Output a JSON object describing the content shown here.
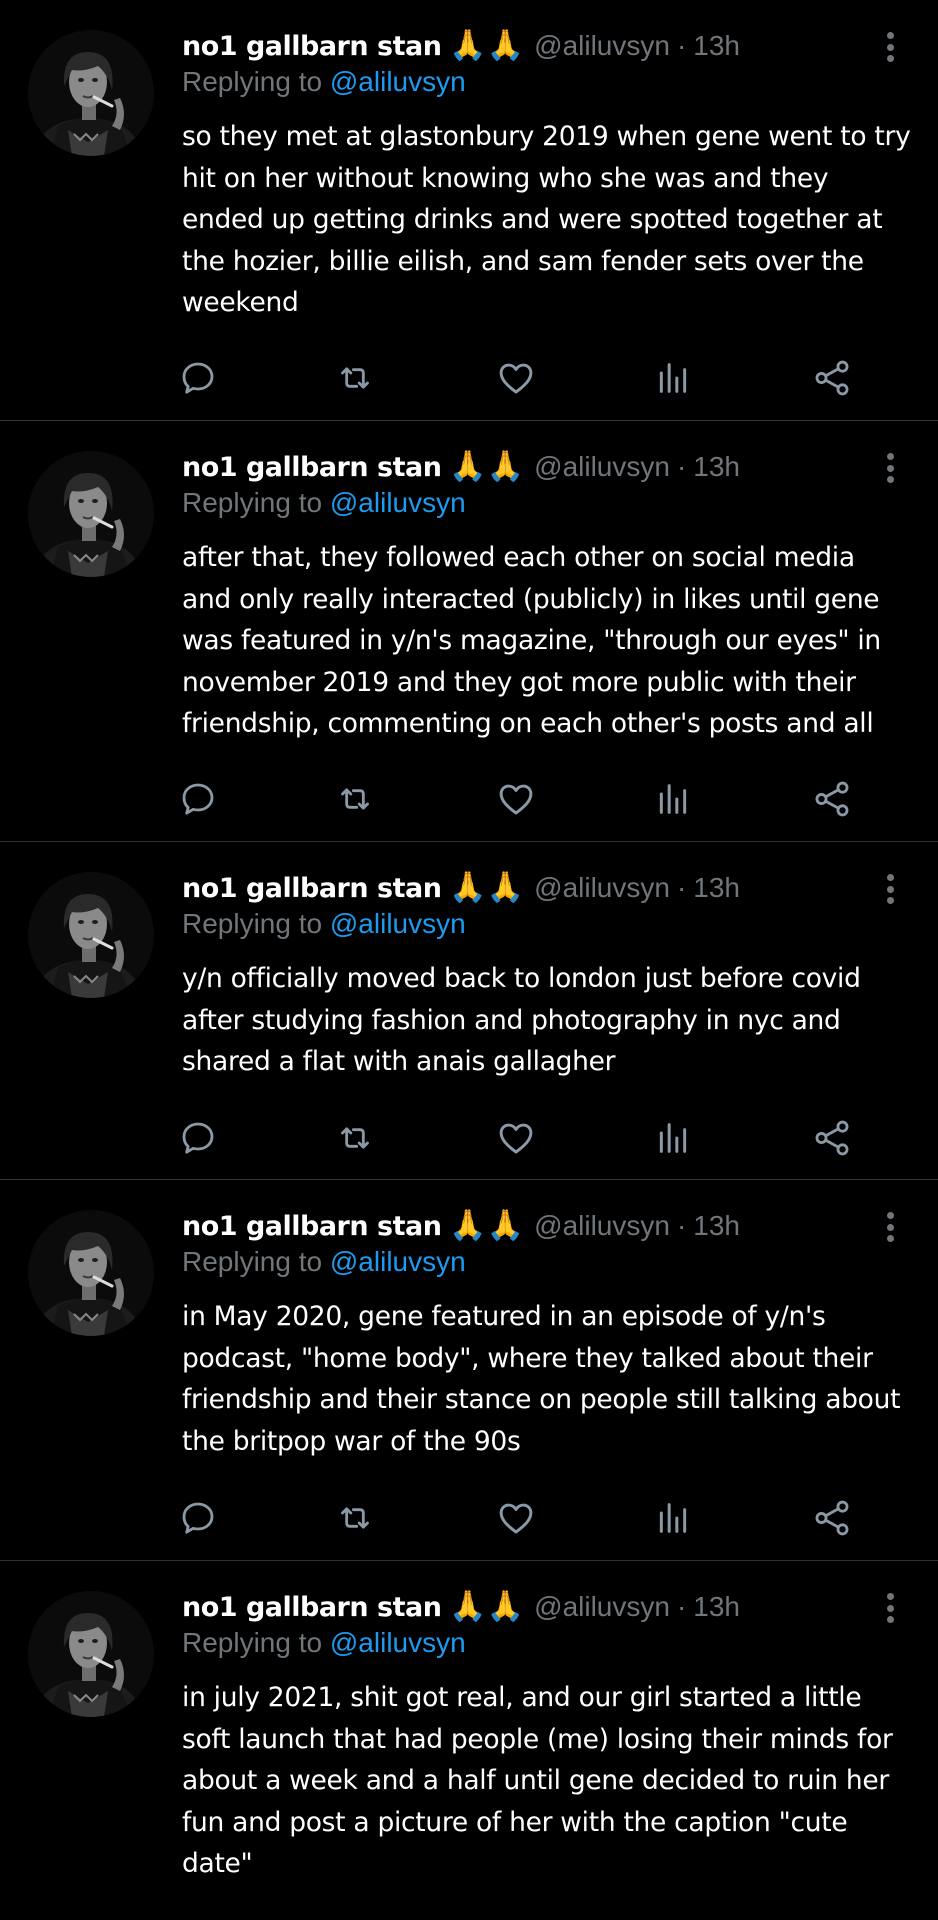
{
  "theme": {
    "background": "#000000",
    "text_primary": "#ffffff",
    "text_secondary": "#71767b",
    "accent": "#1d9bf0",
    "divider": "#2f3336"
  },
  "tweets": [
    {
      "display_name": "no1 gallbarn stan",
      "emoji": "🙏🙏",
      "handle": "@aliluvsyn",
      "separator": "·",
      "time": "13h",
      "replying_prefix": "Replying to",
      "replying_to": "@aliluvsyn",
      "text": "so they met at glastonbury 2019 when gene went to try\nhit on her without knowing who she was and they\nended up getting drinks and were spotted together at\nthe hozier, billie eilish, and sam fender sets over the\nweekend"
    },
    {
      "display_name": "no1 gallbarn stan",
      "emoji": "🙏🙏",
      "handle": "@aliluvsyn",
      "separator": "·",
      "time": "13h",
      "replying_prefix": "Replying to",
      "replying_to": "@aliluvsyn",
      "text": "after that, they followed each other on social media\nand only really interacted (publicly) in likes until gene\nwas featured in y/n's magazine, \"through our eyes\" in\nnovember 2019 and they got more public with their\nfriendship, commenting on each other's posts and all"
    },
    {
      "display_name": "no1 gallbarn stan",
      "emoji": "🙏🙏",
      "handle": "@aliluvsyn",
      "separator": "·",
      "time": "13h",
      "replying_prefix": "Replying to",
      "replying_to": "@aliluvsyn",
      "text": "y/n officially moved back to london just before covid\nafter studying fashion and photography in nyc and\nshared a flat with anais gallagher"
    },
    {
      "display_name": "no1 gallbarn stan",
      "emoji": "🙏🙏",
      "handle": "@aliluvsyn",
      "separator": "·",
      "time": "13h",
      "replying_prefix": "Replying to",
      "replying_to": "@aliluvsyn",
      "text": "in May 2020, gene featured in an episode of y/n's\npodcast, \"home body\", where they talked about their\nfriendship and their stance on people still talking about\nthe britpop war of the 90s"
    },
    {
      "display_name": "no1 gallbarn stan",
      "emoji": "🙏🙏",
      "handle": "@aliluvsyn",
      "separator": "·",
      "time": "13h",
      "replying_prefix": "Replying to",
      "replying_to": "@aliluvsyn",
      "text": "in july 2021, shit got real, and our girl started a little\nsoft launch that had people (me) losing their minds for\nabout a week and a half until gene decided to ruin her\nfun and post a picture of her with the caption \"cute\ndate\""
    }
  ]
}
